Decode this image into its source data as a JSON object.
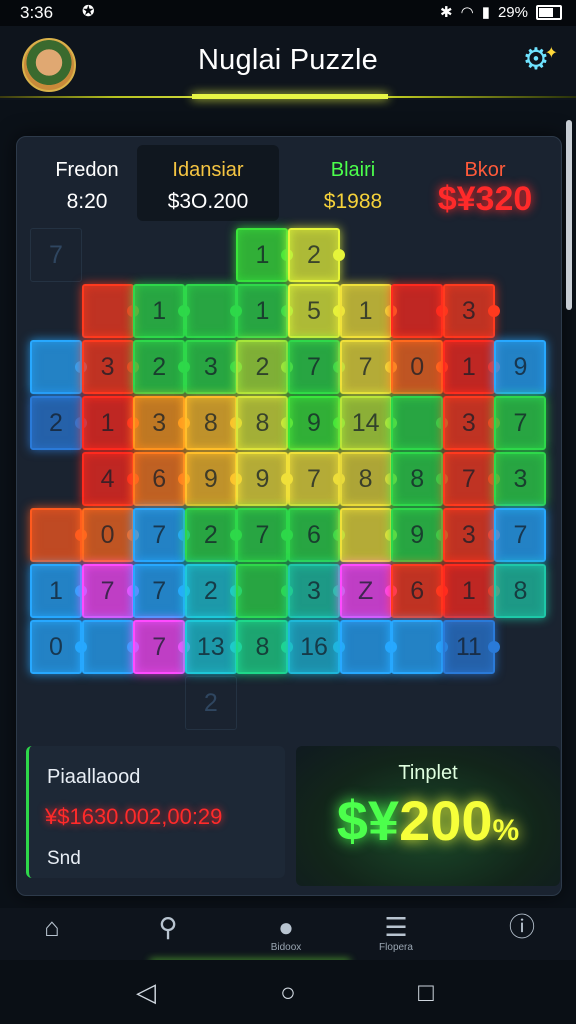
{
  "status_bar": {
    "time": "3:36",
    "battery": "29%",
    "notif_icon": "notification-icon"
  },
  "header": {
    "title": "Nuglai Puzzle",
    "avatar_icon": "avatar",
    "settings_icon": "settings-icon"
  },
  "stats": [
    {
      "label": "Fredon",
      "value": "8:20",
      "label_color": "#ffffff",
      "value_color": "#ffffff"
    },
    {
      "label": "Idansiar",
      "value": "$3O.200",
      "label_color": "#f5c542",
      "value_color": "#ffffff"
    },
    {
      "label": "Blairi",
      "value": "$1988",
      "label_color": "#4cff4c",
      "value_color": "#f6d23a"
    },
    {
      "label": "Bkor",
      "value": "$¥320",
      "label_color": "#ff5a3a",
      "value_color": "#ff2a2a"
    }
  ],
  "board": {
    "ghost_cells": [
      {
        "r": 0,
        "c": 0,
        "n": "7"
      },
      {
        "r": 8,
        "c": 3,
        "n": "2"
      }
    ],
    "tiles": [
      {
        "r": 0,
        "c": 4,
        "n": "1",
        "color": "#3ae63a"
      },
      {
        "r": 0,
        "c": 5,
        "n": "2",
        "color": "#e6f53a"
      },
      {
        "r": 1,
        "c": 1,
        "n": "",
        "color": "#ff3a1e"
      },
      {
        "r": 1,
        "c": 2,
        "n": "1",
        "color": "#2ed84a"
      },
      {
        "r": 1,
        "c": 3,
        "n": "",
        "color": "#2ed84a"
      },
      {
        "r": 1,
        "c": 4,
        "n": "1",
        "color": "#2ed84a"
      },
      {
        "r": 1,
        "c": 5,
        "n": "5",
        "color": "#e6f53a"
      },
      {
        "r": 1,
        "c": 6,
        "n": "1",
        "color": "#f0e03a"
      },
      {
        "r": 1,
        "c": 7,
        "n": "",
        "color": "#ff2a1e"
      },
      {
        "r": 1,
        "c": 8,
        "n": "3",
        "color": "#ff3a1e"
      },
      {
        "r": 2,
        "c": 0,
        "n": "",
        "color": "#27a8ff"
      },
      {
        "r": 2,
        "c": 1,
        "n": "3",
        "color": "#ff3a1e"
      },
      {
        "r": 2,
        "c": 2,
        "n": "2",
        "color": "#2ed84a"
      },
      {
        "r": 2,
        "c": 3,
        "n": "3",
        "color": "#2ed84a"
      },
      {
        "r": 2,
        "c": 4,
        "n": "2",
        "color": "#a6e63a"
      },
      {
        "r": 2,
        "c": 5,
        "n": "7",
        "color": "#2ed84a"
      },
      {
        "r": 2,
        "c": 6,
        "n": "7",
        "color": "#f0e03a"
      },
      {
        "r": 2,
        "c": 7,
        "n": "0",
        "color": "#ff6a1e"
      },
      {
        "r": 2,
        "c": 8,
        "n": "1",
        "color": "#ff2a1e"
      },
      {
        "r": 2,
        "c": 9,
        "n": "9",
        "color": "#27a8ff"
      },
      {
        "r": 3,
        "c": 0,
        "n": "2",
        "color": "#2a7ad8"
      },
      {
        "r": 3,
        "c": 1,
        "n": "1",
        "color": "#ff2a1e"
      },
      {
        "r": 3,
        "c": 2,
        "n": "3",
        "color": "#ff9a1e"
      },
      {
        "r": 3,
        "c": 3,
        "n": "8",
        "color": "#ffbe2a"
      },
      {
        "r": 3,
        "c": 4,
        "n": "8",
        "color": "#d8e63a"
      },
      {
        "r": 3,
        "c": 5,
        "n": "9",
        "color": "#3ae63a"
      },
      {
        "r": 3,
        "c": 6,
        "n": "14",
        "color": "#b8e63a"
      },
      {
        "r": 3,
        "c": 7,
        "n": "",
        "color": "#2ed84a"
      },
      {
        "r": 3,
        "c": 8,
        "n": "3",
        "color": "#ff3a1e"
      },
      {
        "r": 3,
        "c": 9,
        "n": "7",
        "color": "#2ed84a"
      },
      {
        "r": 4,
        "c": 1,
        "n": "4",
        "color": "#ff2a1e"
      },
      {
        "r": 4,
        "c": 2,
        "n": "6",
        "color": "#ff7a1e"
      },
      {
        "r": 4,
        "c": 3,
        "n": "9",
        "color": "#ffbe2a"
      },
      {
        "r": 4,
        "c": 4,
        "n": "9",
        "color": "#f0e03a"
      },
      {
        "r": 4,
        "c": 5,
        "n": "7",
        "color": "#f0e03a"
      },
      {
        "r": 4,
        "c": 6,
        "n": "8",
        "color": "#e6d83a"
      },
      {
        "r": 4,
        "c": 7,
        "n": "8",
        "color": "#2ed84a"
      },
      {
        "r": 4,
        "c": 8,
        "n": "7",
        "color": "#ff3a1e"
      },
      {
        "r": 4,
        "c": 9,
        "n": "3",
        "color": "#2ed84a"
      },
      {
        "r": 5,
        "c": 0,
        "n": "",
        "color": "#ff5a1e"
      },
      {
        "r": 5,
        "c": 1,
        "n": "0",
        "color": "#ff6a1e"
      },
      {
        "r": 5,
        "c": 2,
        "n": "7",
        "color": "#27a8ff"
      },
      {
        "r": 5,
        "c": 3,
        "n": "2",
        "color": "#2ed84a"
      },
      {
        "r": 5,
        "c": 4,
        "n": "7",
        "color": "#2ed84a"
      },
      {
        "r": 5,
        "c": 5,
        "n": "6",
        "color": "#2ed84a"
      },
      {
        "r": 5,
        "c": 6,
        "n": "",
        "color": "#f0e03a"
      },
      {
        "r": 5,
        "c": 7,
        "n": "9",
        "color": "#2ed84a"
      },
      {
        "r": 5,
        "c": 8,
        "n": "3",
        "color": "#ff3a1e"
      },
      {
        "r": 5,
        "c": 9,
        "n": "7",
        "color": "#27a8ff"
      },
      {
        "r": 6,
        "c": 0,
        "n": "1",
        "color": "#27a8ff"
      },
      {
        "r": 6,
        "c": 1,
        "n": "7",
        "color": "#ff4aff"
      },
      {
        "r": 6,
        "c": 2,
        "n": "7",
        "color": "#27a8ff"
      },
      {
        "r": 6,
        "c": 3,
        "n": "2",
        "color": "#1ec8d8"
      },
      {
        "r": 6,
        "c": 4,
        "n": "",
        "color": "#2ed84a"
      },
      {
        "r": 6,
        "c": 5,
        "n": "3",
        "color": "#1ec8a8"
      },
      {
        "r": 6,
        "c": 6,
        "n": "Z",
        "color": "#ff4aff"
      },
      {
        "r": 6,
        "c": 7,
        "n": "6",
        "color": "#ff3a1e"
      },
      {
        "r": 6,
        "c": 8,
        "n": "1",
        "color": "#ff2a1e"
      },
      {
        "r": 6,
        "c": 9,
        "n": "8",
        "color": "#1ec8a8"
      },
      {
        "r": 7,
        "c": 0,
        "n": "0",
        "color": "#27a8ff"
      },
      {
        "r": 7,
        "c": 1,
        "n": "",
        "color": "#27a8ff"
      },
      {
        "r": 7,
        "c": 2,
        "n": "7",
        "color": "#ff4aff"
      },
      {
        "r": 7,
        "c": 3,
        "n": "13",
        "color": "#1ec8d8"
      },
      {
        "r": 7,
        "c": 4,
        "n": "8",
        "color": "#1ed88a"
      },
      {
        "r": 7,
        "c": 5,
        "n": "16",
        "color": "#1eb8d8"
      },
      {
        "r": 7,
        "c": 6,
        "n": "",
        "color": "#27a8ff"
      },
      {
        "r": 7,
        "c": 7,
        "n": "",
        "color": "#27a8ff"
      },
      {
        "r": 7,
        "c": 8,
        "n": "11",
        "color": "#2a7ad8"
      }
    ]
  },
  "bottom_left": {
    "title": "Piaallaood",
    "amount": "¥$1630.002,00:29",
    "sub": "Snd"
  },
  "bottom_right": {
    "label": "Tinplet",
    "value_prefix": "$¥",
    "value": "200",
    "suffix": "%"
  },
  "tabbar": [
    {
      "label": "",
      "icon": "home-icon",
      "glyph": "⌂"
    },
    {
      "label": "",
      "icon": "search-icon",
      "glyph": "⚲"
    },
    {
      "label": "Bidoox",
      "icon": "game-icon",
      "glyph": "●"
    },
    {
      "label": "Flopera",
      "icon": "shop-icon",
      "glyph": "☰"
    },
    {
      "label": "",
      "icon": "info-icon",
      "glyph": "ⓘ"
    }
  ],
  "navbar": [
    {
      "icon": "back-icon",
      "glyph": "◁"
    },
    {
      "icon": "home-nav-icon",
      "glyph": "○"
    },
    {
      "icon": "recents-icon",
      "glyph": "□"
    }
  ]
}
